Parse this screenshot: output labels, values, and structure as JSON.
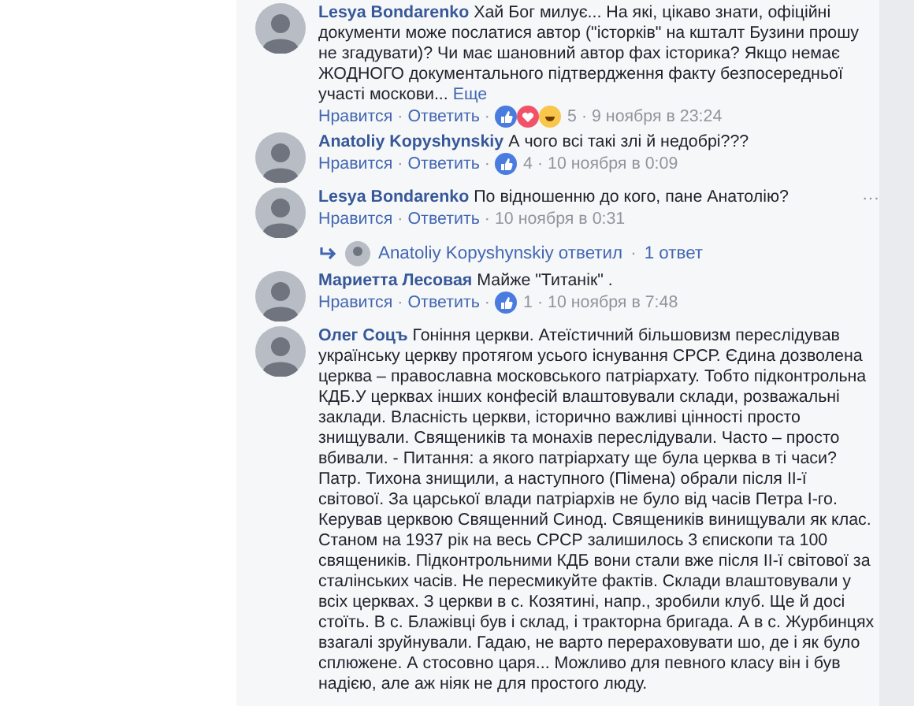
{
  "comments": [
    {
      "author": "Lesya Bondarenko",
      "text": "Хай Бог милує... На які, цікаво знати, офіційні документи може послатися автор (\"історків\" на кшталт Бузини прошу не згадувати)? Чи має шановний автор фах історика? Якщо немає ЖОДНОГО документального підтвердження факту безпосередньої участі москови...",
      "more": "Еще",
      "meta": [
        {
          "kind": "link",
          "text": "Нравится"
        },
        {
          "kind": "sep",
          "text": "·"
        },
        {
          "kind": "link",
          "text": "Ответить"
        },
        {
          "kind": "sep",
          "text": "·"
        },
        {
          "kind": "like"
        },
        {
          "kind": "love"
        },
        {
          "kind": "haha"
        },
        {
          "kind": "count",
          "text": "5"
        },
        {
          "kind": "sep",
          "text": "·"
        },
        {
          "kind": "time",
          "text": "9 ноября в 23:24"
        }
      ]
    },
    {
      "author": "Anatoliy Kopyshynskiy",
      "text": "А чого всі такі злі й недобрі???",
      "meta": [
        {
          "kind": "link",
          "text": "Нравится"
        },
        {
          "kind": "sep",
          "text": "·"
        },
        {
          "kind": "link",
          "text": "Ответить"
        },
        {
          "kind": "sep",
          "text": "·"
        },
        {
          "kind": "like"
        },
        {
          "kind": "count",
          "text": "4"
        },
        {
          "kind": "sep",
          "text": "·"
        },
        {
          "kind": "time",
          "text": "10 ноября в 0:09"
        }
      ]
    },
    {
      "author": "Lesya Bondarenko",
      "text": "По відношенню до кого, пане Анатолію?",
      "menu_icon": "···",
      "meta": [
        {
          "kind": "link",
          "text": "Нравится"
        },
        {
          "kind": "sep",
          "text": "·"
        },
        {
          "kind": "link",
          "text": "Ответить"
        },
        {
          "kind": "sep",
          "text": "·"
        },
        {
          "kind": "time",
          "text": "10 ноября в 0:31"
        }
      ],
      "replies": {
        "author": "Anatoliy Kopyshynskiy ответил",
        "sep": "·",
        "count": "1 ответ"
      }
    },
    {
      "author": "Мариетта Лесовая",
      "text": "Майже \"Титанік\" .",
      "meta": [
        {
          "kind": "link",
          "text": "Нравится"
        },
        {
          "kind": "sep",
          "text": "·"
        },
        {
          "kind": "link",
          "text": "Ответить"
        },
        {
          "kind": "sep",
          "text": "·"
        },
        {
          "kind": "like"
        },
        {
          "kind": "count",
          "text": "1"
        },
        {
          "kind": "sep",
          "text": "·"
        },
        {
          "kind": "time",
          "text": "10 ноября в 7:48"
        }
      ]
    },
    {
      "author": "Олег Соцъ",
      "text": "Гоніння церкви. Атеїстичний більшовизм переслідував українську церкву протягом усього існування СРСР. Єдина дозволена церква – православна московського патріархату. Тобто підконтрольна КДБ.У церквах інших конфесій влаштовували склади, розважальні заклади. Власність церкви, історично важливі цінності просто знищували. Священиків та монахів переслідували. Часто – просто вбивали. - Питання: а якого патріархату ще була церква в ті часи? Патр. Тихона знищили, а наступного (Пімена) обрали після ІІ-ї світової. За царської влади патріархів не було від часів Петра І-го. Керував церквою Священний Синод. Священиків винищували як клас. Станом на 1937 рік на весь СРСР залишилось 3 єпископи та 100 священиків. Підконтрольними КДБ вони стали вже після ІІ-ї світової за сталінських часів. Не пересмикуйте фактів. Склади влаштовували у всіх церквах. З церкви в с. Козятині, напр., зробили клуб. Ще й досі стоїть. В с. Блажівці був і склад, і тракторна бригада. А в с. Журбинцях взагалі зруйнували. Гадаю, не варто перераховувати шо, де і як було сплюжене. А стосовно царя... Можливо для певного класу він і був надією, але аж ніяк не для простого люду."
    }
  ]
}
